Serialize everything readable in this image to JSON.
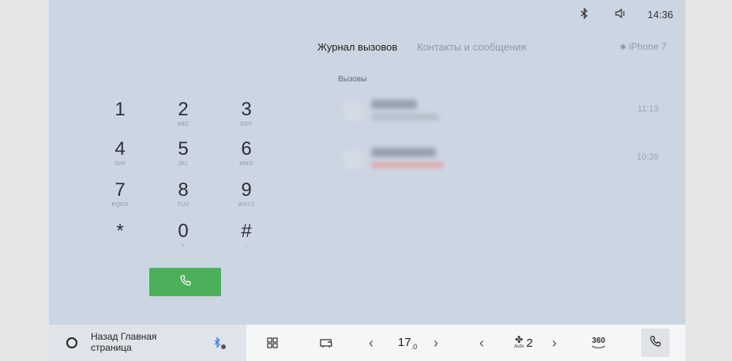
{
  "status": {
    "time": "14:36",
    "icons": [
      "bluetooth-icon",
      "volume-icon"
    ]
  },
  "tabs": {
    "calls": "Журнал вызовов",
    "contacts": "Контакты и сообщения"
  },
  "device": "iPhone 7",
  "keypad": [
    {
      "digit": "1",
      "letters": ""
    },
    {
      "digit": "2",
      "letters": "ABC"
    },
    {
      "digit": "3",
      "letters": "DEF"
    },
    {
      "digit": "4",
      "letters": "GHI"
    },
    {
      "digit": "5",
      "letters": "JKL"
    },
    {
      "digit": "6",
      "letters": "MNO"
    },
    {
      "digit": "7",
      "letters": "PQRS"
    },
    {
      "digit": "8",
      "letters": "TUV"
    },
    {
      "digit": "9",
      "letters": "WXYZ"
    },
    {
      "digit": "*",
      "letters": ","
    },
    {
      "digit": "0",
      "letters": "+"
    },
    {
      "digit": "#",
      "letters": ";"
    }
  ],
  "calls": {
    "title": "Вызовы",
    "items": [
      {
        "time": "11:13"
      },
      {
        "time": "10:39"
      }
    ]
  },
  "bottom": {
    "nav_label": "Назад Главная страница",
    "temperature": "17",
    "temperature_decimal": ".0",
    "fan_level": "2",
    "fan_mode": "Auto",
    "camera_label": "360"
  },
  "colors": {
    "screen_bg": "#ccd6e2",
    "call_button": "#4caf5a",
    "bottom_bar": "#f5f6f8"
  }
}
